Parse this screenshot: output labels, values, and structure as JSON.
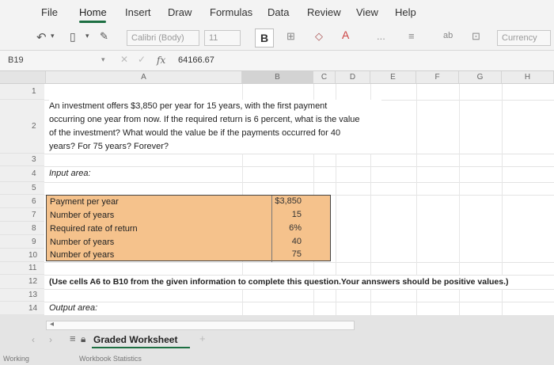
{
  "ribbon": {
    "tabs": [
      "File",
      "Home",
      "Insert",
      "Draw",
      "Formulas",
      "Data",
      "Review",
      "View",
      "Help"
    ],
    "active_tab": "Home"
  },
  "toolbar": {
    "font_name": "Calibri (Body)",
    "font_size": "11",
    "bold_label": "B",
    "number_format": "Currency",
    "more_label": "..."
  },
  "formula_bar": {
    "name_box": "B19",
    "fx_label": "fx",
    "value": "64166.67"
  },
  "columns": [
    "A",
    "B",
    "C",
    "D",
    "E",
    "F",
    "G",
    "H"
  ],
  "rows": [
    "1",
    "2",
    "3",
    "4",
    "5",
    "6",
    "7",
    "8",
    "9",
    "10",
    "11",
    "12",
    "13",
    "14"
  ],
  "sheet": {
    "question_line1": "An investment offers $3,850 per year for 15 years, with the first payment",
    "question_line2": "occurring one year from now. If the required return is 6 percent, what is the value",
    "question_line3": "of the investment? What would the value be if the payments occurred for 40",
    "question_line4": "years? For 75 years? Forever?",
    "input_area_label": "Input area:",
    "inputs": [
      {
        "label": "Payment per year",
        "value": "$3,850"
      },
      {
        "label": "Number of years",
        "value": "15"
      },
      {
        "label": "Required rate of return",
        "value": "6%"
      },
      {
        "label": "Number of years",
        "value": "40"
      },
      {
        "label": "Number of years",
        "value": "75"
      }
    ],
    "instruction": "(Use cells A6 to B10 from the given information to complete this question.Your annswers should be positive values.)",
    "output_area_label": "Output area:"
  },
  "sheet_tabs": {
    "active": "Graded Worksheet",
    "add_label": "+"
  },
  "status_bar": {
    "left": "Working",
    "middle": "Workbook Statistics"
  },
  "colors": {
    "input_fill": "#f5c28c",
    "accent": "#1d6f42"
  }
}
